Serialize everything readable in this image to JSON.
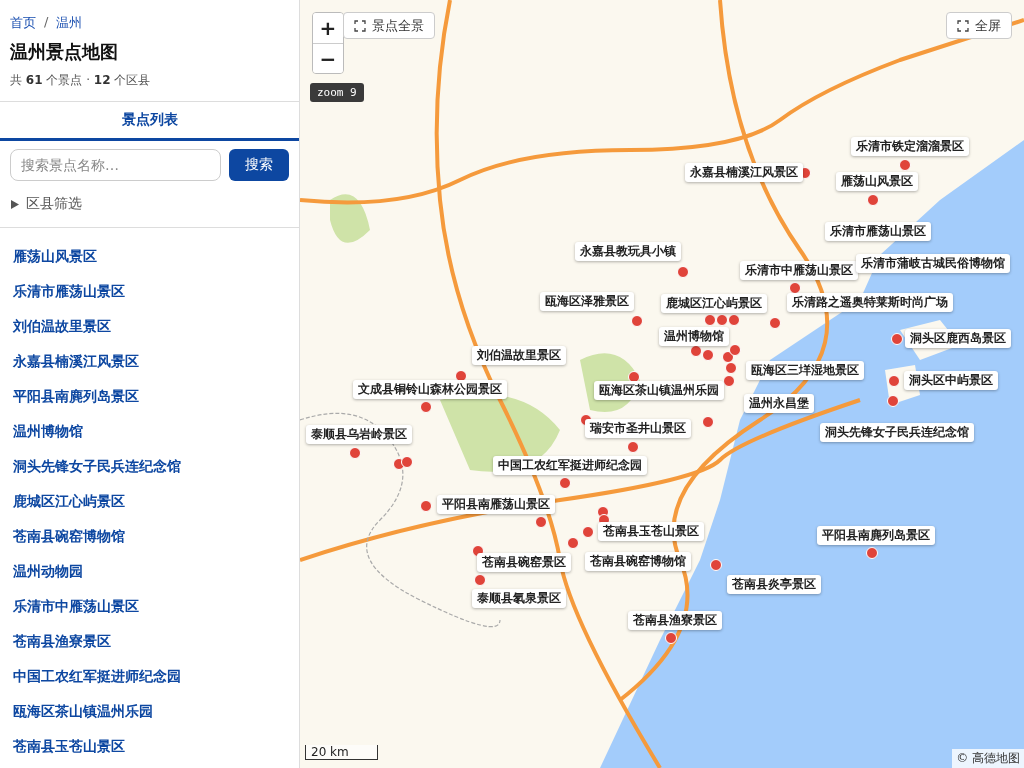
{
  "breadcrumb": [
    "首页",
    "温州"
  ],
  "breadcrumb_separator": "/",
  "title": "温州景点地图",
  "stats": "共 **61** 个景点 · **12** 个区县",
  "tabs": [
    {
      "label": "景点列表",
      "selected": true
    }
  ],
  "search": {
    "placeholder": "搜索景点名称…",
    "button": "搜索"
  },
  "filter": {
    "label": "区县筛选",
    "expanded": false
  },
  "spots": [
    "雁荡山风景区",
    "乐清市雁荡山景区",
    "刘伯温故里景区",
    "永嘉县楠溪江风景区",
    "平阳县南麂列岛景区",
    "温州博物馆",
    "洞头先锋女子民兵连纪念馆",
    "鹿城区江心屿景区",
    "苍南县碗窑博物馆",
    "温州动物园",
    "乐清市中雁荡山景区",
    "苍南县渔寮景区",
    "中国工农红军挺进师纪念园",
    "瓯海区茶山镇温州乐园",
    "苍南县玉苍山景区"
  ],
  "map": {
    "zoom_in": "+",
    "zoom_out": "−",
    "overview_button": "景点全景",
    "fullscreen_button": "全屏",
    "zoom_badge": "zoom 9",
    "scale": "20 km",
    "attribution": "© 高德地图",
    "labels": [
      "乐清市铁定溜溜景区",
      "永嘉县楠溪江风景区",
      "雁荡山风景区",
      "乐清市雁荡山景区",
      "永嘉县教玩具小镇",
      "乐清市中雁荡山景区",
      "乐清市蒲岐古城民俗博物馆",
      "瓯海区泽雅景区",
      "鹿城区江心屿景区",
      "乐清路之遥奥特莱斯时尚广场",
      "温州博物馆",
      "洞头区鹿西岛景区",
      "刘伯温故里景区",
      "瓯海区三垟湿地景区",
      "文成县铜铃山森林公园景区",
      "瓯海区茶山镇温州乐园",
      "洞头区中屿景区",
      "温州永昌堡",
      "泰顺县乌岩岭景区",
      "瑞安市圣井山景区",
      "洞头先锋女子民兵连纪念馆",
      "中国工农红军挺进师纪念园",
      "平阳县南雁荡山景区",
      "苍南县玉苍山景区",
      "平阳县南麂列岛景区",
      "苍南县碗窑景区",
      "苍南县碗窑博物馆",
      "苍南县炎亭景区",
      "泰顺县氡泉景区",
      "苍南县渔寮景区"
    ]
  }
}
